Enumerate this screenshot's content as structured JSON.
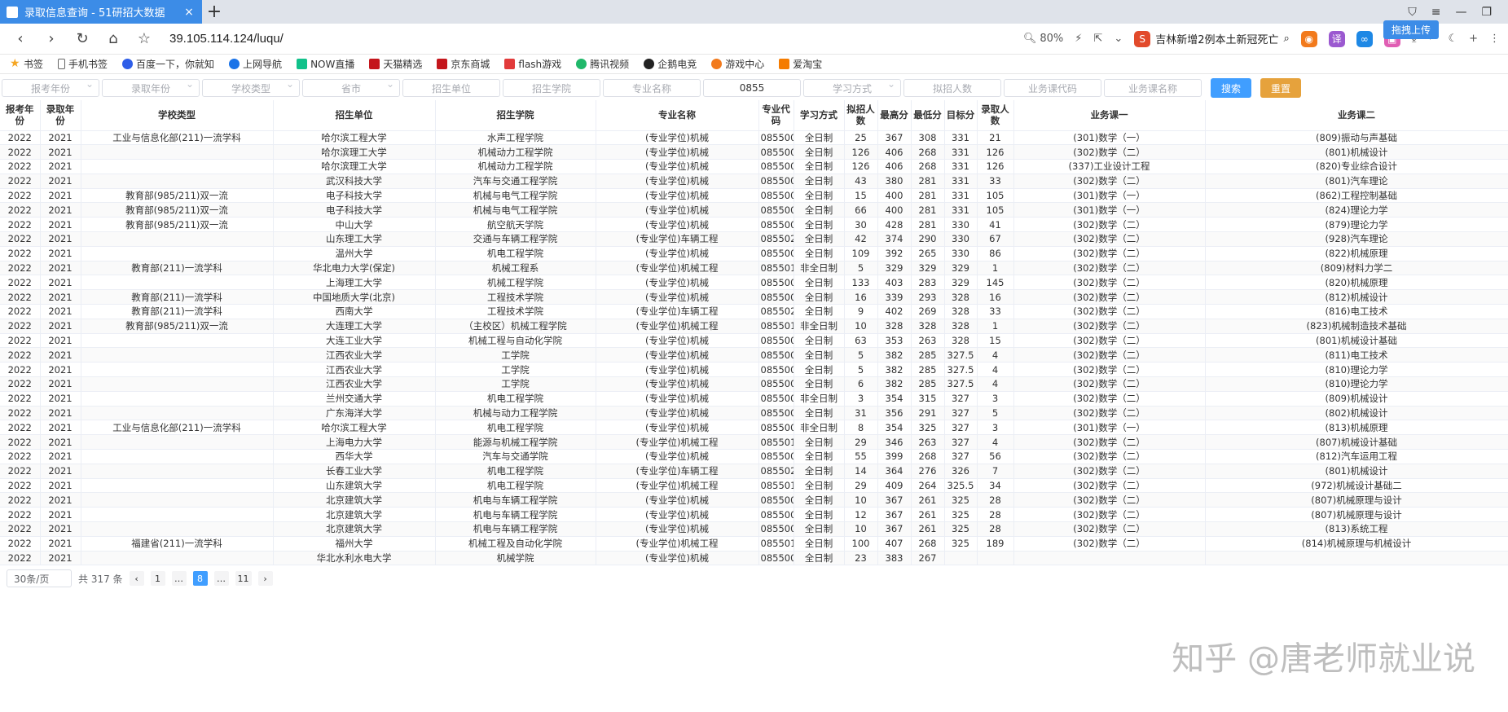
{
  "tab": {
    "title": "录取信息查询 - 51研招大数据",
    "close": "×",
    "newtab": "+"
  },
  "address": {
    "url": "39.105.114.124/luqu/",
    "zoom": "80%",
    "news": "吉林新增2例本土新冠死亡",
    "upload": "拖拽上传"
  },
  "bookmarks": [
    "书签",
    "手机书签",
    "百度一下，你就知",
    "上网导航",
    "NOW直播",
    "天猫精选",
    "京东商城",
    "flash游戏",
    "腾讯视频",
    "企鹅电竞",
    "游戏中心",
    "爱淘宝"
  ],
  "filters": [
    "报考年份",
    "录取年份",
    "学校类型",
    "省市",
    "招生单位",
    "招生学院",
    "专业名称",
    "0855",
    "学习方式",
    "拟招人数",
    "业务课代码",
    "业务课名称"
  ],
  "buttons": {
    "search": "搜索",
    "reset": "重置"
  },
  "table": {
    "headers": [
      "报考年份",
      "录取年份",
      "学校类型",
      "招生单位",
      "招生学院",
      "专业名称",
      "专业代码",
      "学习方式",
      "拟招人数",
      "最高分",
      "最低分",
      "目标分",
      "录取人数",
      "业务课一",
      "业务课二"
    ],
    "rows": [
      [
        "2022",
        "2021",
        "工业与信息化部(211)一流学科",
        "哈尔滨工程大学",
        "水声工程学院",
        "(专业学位)机械",
        "085500",
        "全日制",
        "25",
        "367",
        "308",
        "331",
        "21",
        "(301)数学（一）",
        "(809)振动与声基础"
      ],
      [
        "2022",
        "2021",
        "",
        "哈尔滨理工大学",
        "机械动力工程学院",
        "(专业学位)机械",
        "085500",
        "全日制",
        "126",
        "406",
        "268",
        "331",
        "126",
        "(302)数学（二）",
        "(801)机械设计"
      ],
      [
        "2022",
        "2021",
        "",
        "哈尔滨理工大学",
        "机械动力工程学院",
        "(专业学位)机械",
        "085500",
        "全日制",
        "126",
        "406",
        "268",
        "331",
        "126",
        "(337)工业设计工程",
        "(820)专业综合设计"
      ],
      [
        "2022",
        "2021",
        "",
        "武汉科技大学",
        "汽车与交通工程学院",
        "(专业学位)机械",
        "085500",
        "全日制",
        "43",
        "380",
        "281",
        "331",
        "33",
        "(302)数学（二）",
        "(801)汽车理论"
      ],
      [
        "2022",
        "2021",
        "教育部(985/211)双一流",
        "电子科技大学",
        "机械与电气工程学院",
        "(专业学位)机械",
        "085500",
        "全日制",
        "15",
        "400",
        "281",
        "331",
        "105",
        "(301)数学（一）",
        "(862)工程控制基础"
      ],
      [
        "2022",
        "2021",
        "教育部(985/211)双一流",
        "电子科技大学",
        "机械与电气工程学院",
        "(专业学位)机械",
        "085500",
        "全日制",
        "66",
        "400",
        "281",
        "331",
        "105",
        "(301)数学（一）",
        "(824)理论力学"
      ],
      [
        "2022",
        "2021",
        "教育部(985/211)双一流",
        "中山大学",
        "航空航天学院",
        "(专业学位)机械",
        "085500",
        "全日制",
        "30",
        "428",
        "281",
        "330",
        "41",
        "(302)数学（二）",
        "(879)理论力学"
      ],
      [
        "2022",
        "2021",
        "",
        "山东理工大学",
        "交通与车辆工程学院",
        "(专业学位)车辆工程",
        "085502",
        "全日制",
        "42",
        "374",
        "290",
        "330",
        "67",
        "(302)数学（二）",
        "(928)汽车理论"
      ],
      [
        "2022",
        "2021",
        "",
        "温州大学",
        "机电工程学院",
        "(专业学位)机械",
        "085500",
        "全日制",
        "109",
        "392",
        "265",
        "330",
        "86",
        "(302)数学（二）",
        "(822)机械原理"
      ],
      [
        "2022",
        "2021",
        "教育部(211)一流学科",
        "华北电力大学(保定)",
        "机械工程系",
        "(专业学位)机械工程",
        "085501",
        "非全日制",
        "5",
        "329",
        "329",
        "329",
        "1",
        "(302)数学（二）",
        "(809)材料力学二"
      ],
      [
        "2022",
        "2021",
        "",
        "上海理工大学",
        "机械工程学院",
        "(专业学位)机械",
        "085500",
        "全日制",
        "133",
        "403",
        "283",
        "329",
        "145",
        "(302)数学（二）",
        "(820)机械原理"
      ],
      [
        "2022",
        "2021",
        "教育部(211)一流学科",
        "中国地质大学(北京)",
        "工程技术学院",
        "(专业学位)机械",
        "085500",
        "全日制",
        "16",
        "339",
        "293",
        "328",
        "16",
        "(302)数学（二）",
        "(812)机械设计"
      ],
      [
        "2022",
        "2021",
        "教育部(211)一流学科",
        "西南大学",
        "工程技术学院",
        "(专业学位)车辆工程",
        "085502",
        "全日制",
        "9",
        "402",
        "269",
        "328",
        "33",
        "(302)数学（二）",
        "(816)电工技术"
      ],
      [
        "2022",
        "2021",
        "教育部(985/211)双一流",
        "大连理工大学",
        "（主校区）机械工程学院",
        "(专业学位)机械工程",
        "085501",
        "非全日制",
        "10",
        "328",
        "328",
        "328",
        "1",
        "(302)数学（二）",
        "(823)机械制造技术基础"
      ],
      [
        "2022",
        "2021",
        "",
        "大连工业大学",
        "机械工程与自动化学院",
        "(专业学位)机械",
        "085500",
        "全日制",
        "63",
        "353",
        "263",
        "328",
        "15",
        "(302)数学（二）",
        "(801)机械设计基础"
      ],
      [
        "2022",
        "2021",
        "",
        "江西农业大学",
        "工学院",
        "(专业学位)机械",
        "085500",
        "全日制",
        "5",
        "382",
        "285",
        "327.5",
        "4",
        "(302)数学（二）",
        "(811)电工技术"
      ],
      [
        "2022",
        "2021",
        "",
        "江西农业大学",
        "工学院",
        "(专业学位)机械",
        "085500",
        "全日制",
        "5",
        "382",
        "285",
        "327.5",
        "4",
        "(302)数学（二）",
        "(810)理论力学"
      ],
      [
        "2022",
        "2021",
        "",
        "江西农业大学",
        "工学院",
        "(专业学位)机械",
        "085500",
        "全日制",
        "6",
        "382",
        "285",
        "327.5",
        "4",
        "(302)数学（二）",
        "(810)理论力学"
      ],
      [
        "2022",
        "2021",
        "",
        "兰州交通大学",
        "机电工程学院",
        "(专业学位)机械",
        "085500",
        "非全日制",
        "3",
        "354",
        "315",
        "327",
        "3",
        "(302)数学（二）",
        "(809)机械设计"
      ],
      [
        "2022",
        "2021",
        "",
        "广东海洋大学",
        "机械与动力工程学院",
        "(专业学位)机械",
        "085500",
        "全日制",
        "31",
        "356",
        "291",
        "327",
        "5",
        "(302)数学（二）",
        "(802)机械设计"
      ],
      [
        "2022",
        "2021",
        "工业与信息化部(211)一流学科",
        "哈尔滨工程大学",
        "机电工程学院",
        "(专业学位)机械",
        "085500",
        "非全日制",
        "8",
        "354",
        "325",
        "327",
        "3",
        "(301)数学（一）",
        "(813)机械原理"
      ],
      [
        "2022",
        "2021",
        "",
        "上海电力大学",
        "能源与机械工程学院",
        "(专业学位)机械工程",
        "085501",
        "全日制",
        "29",
        "346",
        "263",
        "327",
        "4",
        "(302)数学（二）",
        "(807)机械设计基础"
      ],
      [
        "2022",
        "2021",
        "",
        "西华大学",
        "汽车与交通学院",
        "(专业学位)机械",
        "085500",
        "全日制",
        "55",
        "399",
        "268",
        "327",
        "56",
        "(302)数学（二）",
        "(812)汽车运用工程"
      ],
      [
        "2022",
        "2021",
        "",
        "长春工业大学",
        "机电工程学院",
        "(专业学位)车辆工程",
        "085502",
        "全日制",
        "14",
        "364",
        "276",
        "326",
        "7",
        "(302)数学（二）",
        "(801)机械设计"
      ],
      [
        "2022",
        "2021",
        "",
        "山东建筑大学",
        "机电工程学院",
        "(专业学位)机械工程",
        "085501",
        "全日制",
        "29",
        "409",
        "264",
        "325.5",
        "34",
        "(302)数学（二）",
        "(972)机械设计基础二"
      ],
      [
        "2022",
        "2021",
        "",
        "北京建筑大学",
        "机电与车辆工程学院",
        "(专业学位)机械",
        "085500",
        "全日制",
        "10",
        "367",
        "261",
        "325",
        "28",
        "(302)数学（二）",
        "(807)机械原理与设计"
      ],
      [
        "2022",
        "2021",
        "",
        "北京建筑大学",
        "机电与车辆工程学院",
        "(专业学位)机械",
        "085500",
        "全日制",
        "12",
        "367",
        "261",
        "325",
        "28",
        "(302)数学（二）",
        "(807)机械原理与设计"
      ],
      [
        "2022",
        "2021",
        "",
        "北京建筑大学",
        "机电与车辆工程学院",
        "(专业学位)机械",
        "085500",
        "全日制",
        "10",
        "367",
        "261",
        "325",
        "28",
        "(302)数学（二）",
        "(813)系统工程"
      ],
      [
        "2022",
        "2021",
        "福建省(211)一流学科",
        "福州大学",
        "机械工程及自动化学院",
        "(专业学位)机械工程",
        "085501",
        "全日制",
        "100",
        "407",
        "268",
        "325",
        "189",
        "(302)数学（二）",
        "(814)机械原理与机械设计"
      ],
      [
        "2022",
        "2021",
        "",
        "华北水利水电大学",
        "机械学院",
        "(专业学位)机械",
        "085500",
        "全日制",
        "23",
        "383",
        "267",
        "",
        "",
        "",
        ""
      ]
    ]
  },
  "pager": {
    "pagesize": "30条/页",
    "total": "共 317 条",
    "pages": [
      "1",
      "…",
      "8",
      "…",
      "11"
    ],
    "active": "8"
  },
  "watermark": "知乎 @唐老师就业说"
}
